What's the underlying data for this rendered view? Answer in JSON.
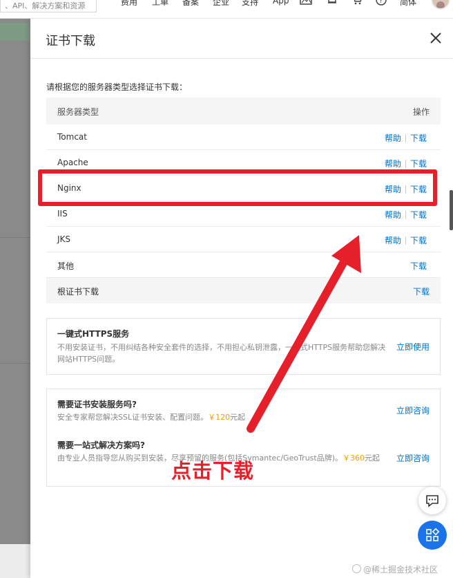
{
  "topnav": {
    "search_text": "、API、解决方案和资源",
    "items": [
      "费用",
      "工单",
      "备案",
      "企业",
      "支持",
      "App"
    ],
    "lang": "简体"
  },
  "drawer": {
    "title": "证书下载",
    "subtitle": "请根据您的服务器类型选择证书下载：",
    "table": {
      "col_server": "服务器类型",
      "col_action": "操作",
      "help_label": "帮助",
      "download_label": "下载",
      "rows": [
        {
          "name": "Tomcat"
        },
        {
          "name": "Apache"
        },
        {
          "name": "Nginx"
        },
        {
          "name": "IIS"
        },
        {
          "name": "JKS"
        },
        {
          "name": "其他"
        },
        {
          "name": "根证书下载"
        }
      ]
    },
    "https_card": {
      "title": "一键式HTTPS服务",
      "desc": "不用安装证书，不用纠结各种安全套件的选择，不用担心私钥泄露，一键式HTTPS服务帮助您解决网站HTTPS问题。",
      "cta": "立即使用"
    },
    "service_card": {
      "q1_title": "需要证书安装服务吗?",
      "q1_desc_prefix": "安全专家帮您解决SSL证书安装、配置问题。",
      "q1_price": "￥120",
      "q1_desc_suffix": "元起",
      "q1_cta": "立即咨询",
      "q2_title": "需要一站式解决方案吗?",
      "q2_desc_prefix": "由专业人员指导您从购买到安装，尽享预留的服务(包括Symantec/GeoTrust品牌)。",
      "q2_price": "￥360",
      "q2_desc_suffix": "元起",
      "q2_cta": "立即咨询"
    }
  },
  "annotation": {
    "text": "点击下载",
    "color": "#e5202b"
  },
  "watermark": "@稀土掘金技术社区",
  "colors": {
    "link": "#0070cc",
    "price": "#f0a000",
    "fab": "#1a73e8"
  }
}
